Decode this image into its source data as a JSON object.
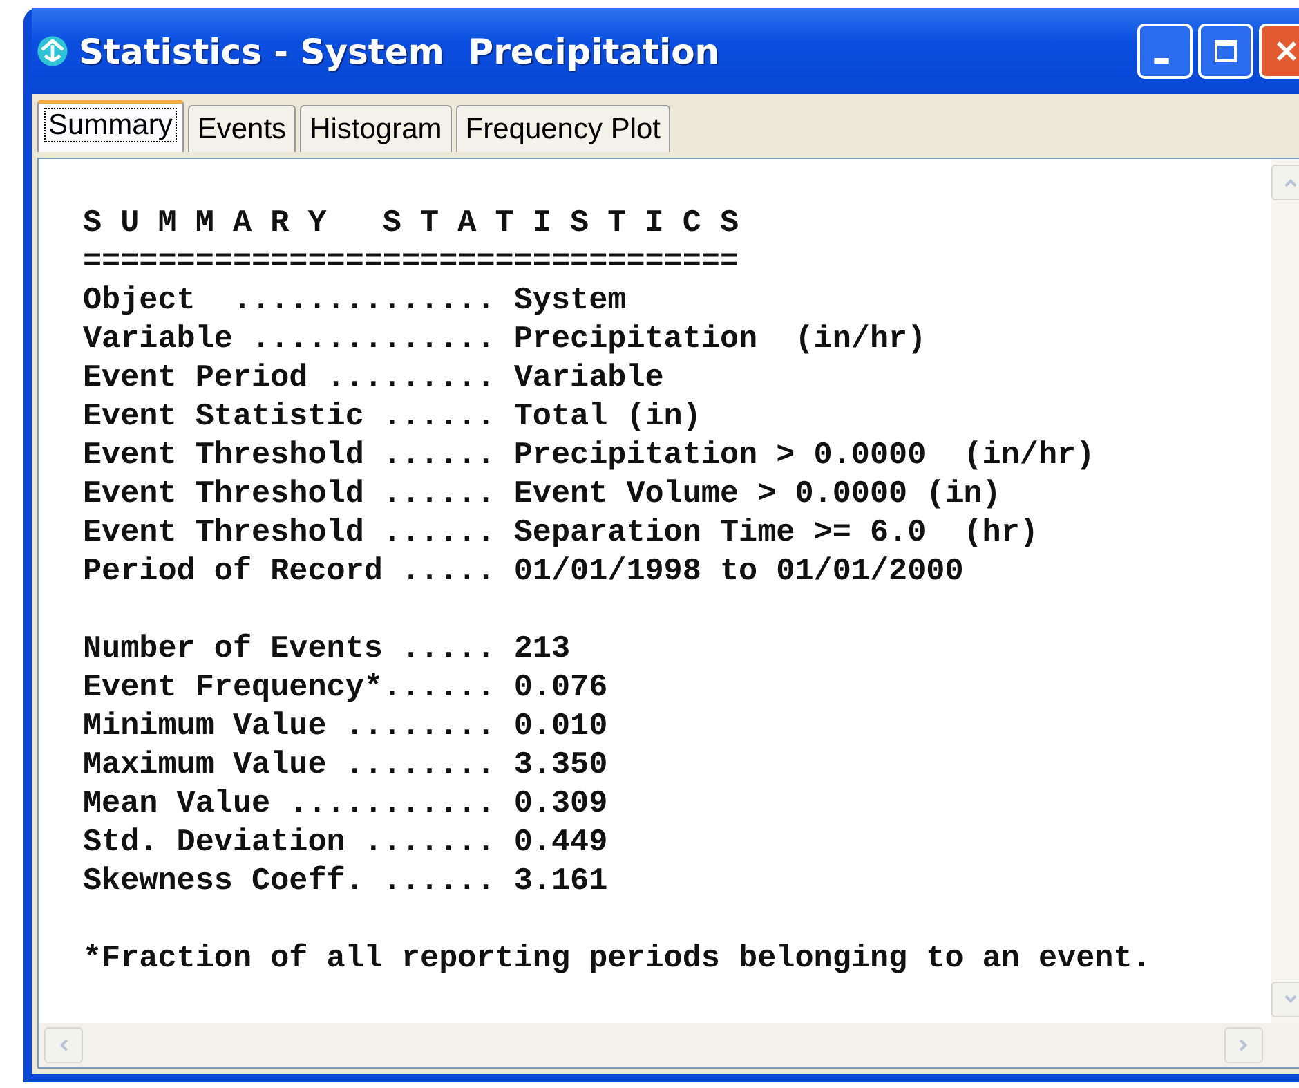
{
  "window": {
    "title": "Statistics - System  Precipitation"
  },
  "tabs": [
    {
      "label": "Summary",
      "selected": true
    },
    {
      "label": "Events",
      "selected": false
    },
    {
      "label": "Histogram",
      "selected": false
    },
    {
      "label": "Frequency Plot",
      "selected": false
    }
  ],
  "report": {
    "sections": [
      [
        "S U M M A R Y   S T A T I S T I C S",
        "===================================",
        "Object  .............. System",
        "Variable ............. Precipitation  (in/hr)",
        "Event Period ......... Variable",
        "Event Statistic ...... Total (in)",
        "Event Threshold ...... Precipitation > 0.0000  (in/hr)",
        "Event Threshold ...... Event Volume > 0.0000 (in)",
        "Event Threshold ...... Separation Time >= 6.0  (hr)",
        "Period of Record ..... 01/01/1998 to 01/01/2000"
      ],
      [
        "Number of Events ..... 213",
        "Event Frequency*...... 0.076",
        "Minimum Value ........ 0.010",
        "Maximum Value ........ 3.350",
        "Mean Value ........... 0.309",
        "Std. Deviation ....... 0.449",
        "Skewness Coeff. ...... 3.161"
      ],
      [
        "*Fraction of all reporting periods belonging to an event."
      ]
    ]
  }
}
